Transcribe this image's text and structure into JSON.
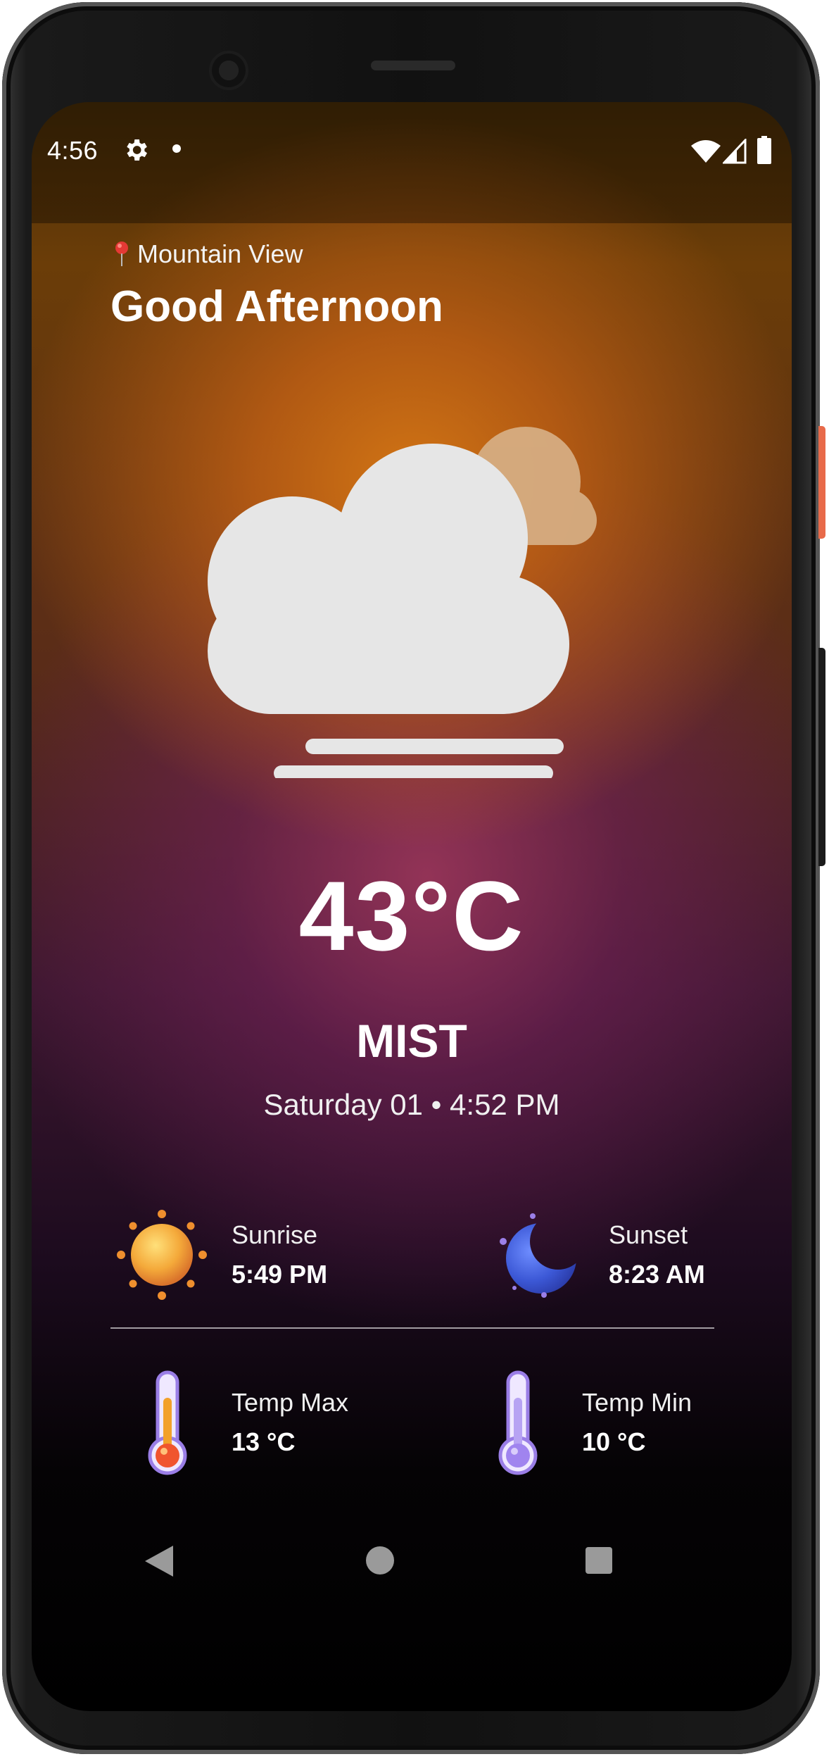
{
  "status_bar": {
    "time": "4:56",
    "icons": [
      "gear-icon",
      "notification-dot",
      "wifi-icon",
      "signal-icon",
      "battery-icon"
    ]
  },
  "location": {
    "icon": "location-pin-icon",
    "name": "Mountain View"
  },
  "greeting": "Good Afternoon",
  "current": {
    "icon": "mist-cloud-icon",
    "temperature": "43°C",
    "condition": "MIST",
    "datetime": "Saturday 01 • 4:52 PM"
  },
  "details": {
    "sunrise": {
      "icon": "sun-icon",
      "label": "Sunrise",
      "value": "5:49 PM"
    },
    "sunset": {
      "icon": "moon-icon",
      "label": "Sunset",
      "value": "8:23 AM"
    },
    "temp_max": {
      "icon": "thermometer-hot-icon",
      "label": "Temp Max",
      "value": "13 °C"
    },
    "temp_min": {
      "icon": "thermometer-cold-icon",
      "label": "Temp Min",
      "value": "10 °C"
    }
  },
  "navigation": {
    "icons": [
      "back-icon",
      "home-icon",
      "recents-icon"
    ]
  },
  "colors": {
    "accent_orange": "#d47614",
    "accent_purple": "#a0375f",
    "background_dark": "#000000",
    "text": "#ffffff"
  }
}
